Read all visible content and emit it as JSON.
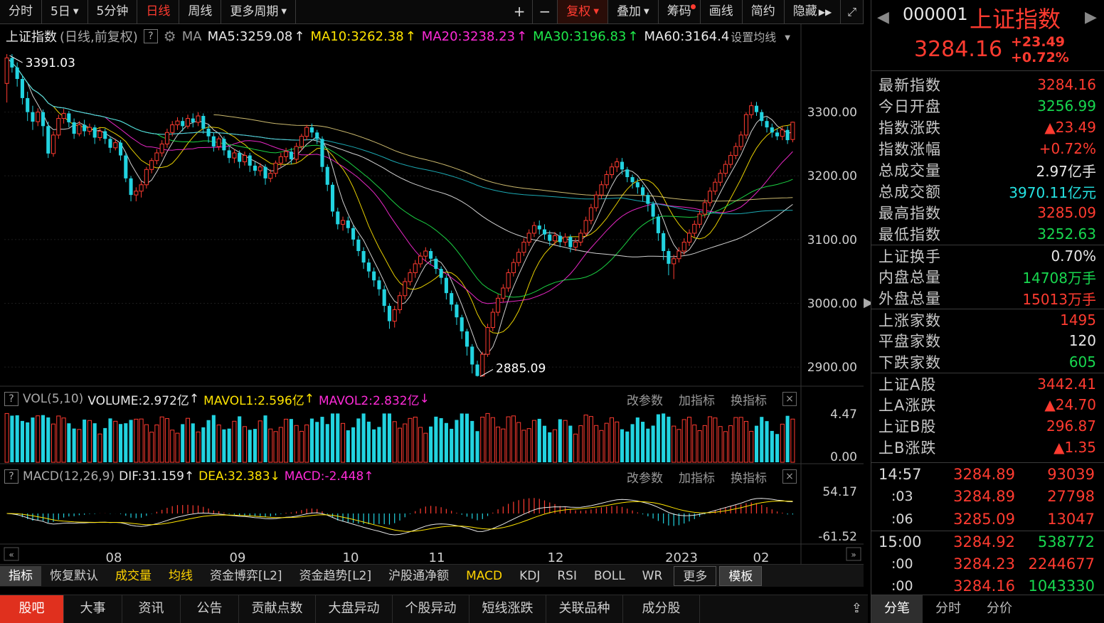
{
  "toolbar": {
    "tabs": [
      "分时",
      "5日",
      "5分钟",
      "日线",
      "周线",
      "更多周期"
    ],
    "active_tab": "日线",
    "tools": [
      "+",
      "−",
      "复权",
      "叠加",
      "筹码",
      "画线",
      "简约",
      "隐藏"
    ]
  },
  "info": {
    "name": "上证指数",
    "mode": "(日线,前复权)",
    "help": "?",
    "ma_label": "MA",
    "ma5": "MA5:3259.08",
    "ma10": "MA10:3262.38",
    "ma20": "MA20:3238.23",
    "ma30": "MA30:3196.83",
    "ma60": "MA60:3164.4",
    "set_ma": "设置均线"
  },
  "vol_head": {
    "help": "?",
    "name": "VOL(5,10)",
    "volume": "VOLUME:2.972亿",
    "mavol1": "MAVOL1:2.596亿",
    "mavol2": "MAVOL2:2.832亿",
    "actions": [
      "改参数",
      "加指标",
      "换指标"
    ],
    "close": "×"
  },
  "macd_head": {
    "help": "?",
    "name": "MACD(12,26,9)",
    "dif": "DIF:31.159",
    "dea": "DEA:32.383",
    "macd": "MACD:-2.448",
    "actions": [
      "改参数",
      "加指标",
      "换指标"
    ],
    "close": "×"
  },
  "axis": {
    "price_ticks": [
      "3300.00",
      "3200.00",
      "3100.00",
      "3000.00",
      "2900.00"
    ],
    "vol_ticks": [
      "4.47",
      "0.00"
    ],
    "macd_ticks": [
      "54.17",
      "-61.52"
    ],
    "x_labels": [
      "08",
      "09",
      "10",
      "11",
      "12",
      "2023",
      "02"
    ],
    "high_label": "3391.03",
    "low_label": "2885.09"
  },
  "colors": {
    "up": "#ff3b30",
    "down": "#22d3e0",
    "ma5": "#e8e8e8",
    "ma10": "#ffe400",
    "ma20": "#ff2bd8",
    "ma30": "#1ee84a",
    "ma60": "#e8e8e8",
    "dif": "#e8e8e8",
    "dea": "#ffe400"
  },
  "chart_data": {
    "type": "candlestick",
    "title": "上证指数",
    "x_labels": [
      "08",
      "09",
      "10",
      "11",
      "12",
      "2023",
      "02"
    ],
    "ylim": [
      2870,
      3400
    ],
    "candles": [
      [
        3345,
        3385,
        3315,
        3391
      ],
      [
        3385,
        3370,
        3362,
        3391
      ],
      [
        3370,
        3352,
        3340,
        3378
      ],
      [
        3352,
        3322,
        3312,
        3358
      ],
      [
        3322,
        3300,
        3286,
        3332
      ],
      [
        3300,
        3285,
        3272,
        3310
      ],
      [
        3285,
        3300,
        3278,
        3306
      ],
      [
        3300,
        3278,
        3262,
        3304
      ],
      [
        3278,
        3235,
        3228,
        3285
      ],
      [
        3235,
        3264,
        3230,
        3270
      ],
      [
        3264,
        3290,
        3258,
        3296
      ],
      [
        3290,
        3298,
        3282,
        3305
      ],
      [
        3298,
        3284,
        3276,
        3302
      ],
      [
        3284,
        3266,
        3258,
        3290
      ],
      [
        3266,
        3280,
        3262,
        3286
      ],
      [
        3280,
        3270,
        3262,
        3288
      ],
      [
        3270,
        3276,
        3264,
        3282
      ],
      [
        3276,
        3260,
        3250,
        3280
      ],
      [
        3260,
        3270,
        3255,
        3275
      ],
      [
        3270,
        3258,
        3250,
        3274
      ],
      [
        3258,
        3244,
        3236,
        3262
      ],
      [
        3244,
        3252,
        3240,
        3258
      ],
      [
        3252,
        3232,
        3224,
        3256
      ],
      [
        3232,
        3196,
        3190,
        3236
      ],
      [
        3196,
        3170,
        3160,
        3200
      ],
      [
        3170,
        3176,
        3160,
        3182
      ],
      [
        3176,
        3186,
        3166,
        3192
      ],
      [
        3186,
        3210,
        3180,
        3214
      ],
      [
        3210,
        3224,
        3204,
        3228
      ],
      [
        3224,
        3236,
        3218,
        3242
      ],
      [
        3236,
        3250,
        3230,
        3256
      ],
      [
        3250,
        3268,
        3244,
        3274
      ],
      [
        3268,
        3280,
        3262,
        3286
      ],
      [
        3280,
        3286,
        3272,
        3292
      ],
      [
        3286,
        3278,
        3270,
        3292
      ],
      [
        3278,
        3290,
        3274,
        3296
      ],
      [
        3290,
        3284,
        3276,
        3298
      ],
      [
        3284,
        3294,
        3278,
        3300
      ],
      [
        3294,
        3274,
        3266,
        3298
      ],
      [
        3274,
        3262,
        3252,
        3280
      ],
      [
        3262,
        3246,
        3238,
        3268
      ],
      [
        3246,
        3258,
        3240,
        3262
      ],
      [
        3258,
        3240,
        3232,
        3262
      ],
      [
        3240,
        3228,
        3220,
        3246
      ],
      [
        3228,
        3236,
        3220,
        3242
      ],
      [
        3236,
        3222,
        3212,
        3240
      ],
      [
        3222,
        3232,
        3216,
        3238
      ],
      [
        3232,
        3216,
        3206,
        3236
      ],
      [
        3216,
        3208,
        3200,
        3222
      ],
      [
        3208,
        3214,
        3200,
        3220
      ],
      [
        3214,
        3196,
        3186,
        3218
      ],
      [
        3196,
        3204,
        3190,
        3210
      ],
      [
        3204,
        3220,
        3198,
        3224
      ],
      [
        3220,
        3230,
        3214,
        3236
      ],
      [
        3230,
        3238,
        3222,
        3244
      ],
      [
        3238,
        3226,
        3218,
        3244
      ],
      [
        3226,
        3246,
        3220,
        3252
      ],
      [
        3246,
        3262,
        3240,
        3266
      ],
      [
        3262,
        3276,
        3256,
        3280
      ],
      [
        3276,
        3268,
        3260,
        3282
      ],
      [
        3268,
        3258,
        3250,
        3272
      ],
      [
        3258,
        3214,
        3206,
        3262
      ],
      [
        3214,
        3186,
        3176,
        3218
      ],
      [
        3186,
        3144,
        3136,
        3190
      ],
      [
        3144,
        3124,
        3116,
        3150
      ],
      [
        3124,
        3130,
        3114,
        3136
      ],
      [
        3130,
        3118,
        3110,
        3136
      ],
      [
        3118,
        3100,
        3090,
        3122
      ],
      [
        3100,
        3082,
        3074,
        3106
      ],
      [
        3082,
        3064,
        3054,
        3088
      ],
      [
        3064,
        3050,
        3040,
        3070
      ],
      [
        3050,
        3036,
        3026,
        3056
      ],
      [
        3036,
        3022,
        3012,
        3042
      ],
      [
        3022,
        2996,
        2986,
        3028
      ],
      [
        2996,
        2972,
        2960,
        3000
      ],
      [
        2972,
        2990,
        2962,
        2996
      ],
      [
        2990,
        3012,
        2984,
        3018
      ],
      [
        3012,
        3034,
        3006,
        3040
      ],
      [
        3034,
        3048,
        3028,
        3054
      ],
      [
        3048,
        3062,
        3040,
        3068
      ],
      [
        3062,
        3074,
        3056,
        3080
      ],
      [
        3074,
        3082,
        3066,
        3088
      ],
      [
        3082,
        3070,
        3062,
        3086
      ],
      [
        3070,
        3054,
        3046,
        3074
      ],
      [
        3054,
        3040,
        3030,
        3058
      ],
      [
        3040,
        3016,
        3006,
        3044
      ],
      [
        3016,
        2998,
        2988,
        3020
      ],
      [
        2998,
        2978,
        2966,
        3002
      ],
      [
        2978,
        2956,
        2944,
        2982
      ],
      [
        2956,
        2932,
        2918,
        2960
      ],
      [
        2932,
        2904,
        2890,
        2936
      ],
      [
        2904,
        2886,
        2885.09,
        2910
      ],
      [
        2886,
        2920,
        2885.09,
        2924
      ],
      [
        2920,
        2962,
        2916,
        2968
      ],
      [
        2962,
        2986,
        2956,
        2992
      ],
      [
        2986,
        3008,
        2980,
        3014
      ],
      [
        3008,
        3024,
        3002,
        3030
      ],
      [
        3024,
        3048,
        3018,
        3054
      ],
      [
        3048,
        3064,
        3042,
        3070
      ],
      [
        3064,
        3080,
        3058,
        3086
      ],
      [
        3080,
        3096,
        3074,
        3102
      ],
      [
        3096,
        3110,
        3090,
        3116
      ],
      [
        3110,
        3122,
        3104,
        3128
      ],
      [
        3122,
        3116,
        3108,
        3130
      ],
      [
        3116,
        3108,
        3100,
        3124
      ],
      [
        3108,
        3098,
        3090,
        3114
      ],
      [
        3098,
        3106,
        3092,
        3112
      ],
      [
        3106,
        3096,
        3088,
        3112
      ],
      [
        3096,
        3104,
        3090,
        3110
      ],
      [
        3104,
        3088,
        3080,
        3108
      ],
      [
        3088,
        3096,
        3082,
        3102
      ],
      [
        3096,
        3110,
        3090,
        3116
      ],
      [
        3110,
        3130,
        3104,
        3136
      ],
      [
        3130,
        3150,
        3124,
        3156
      ],
      [
        3150,
        3170,
        3144,
        3176
      ],
      [
        3170,
        3186,
        3164,
        3192
      ],
      [
        3186,
        3202,
        3180,
        3208
      ],
      [
        3202,
        3214,
        3196,
        3220
      ],
      [
        3214,
        3222,
        3206,
        3228
      ],
      [
        3222,
        3210,
        3202,
        3228
      ],
      [
        3210,
        3198,
        3190,
        3214
      ],
      [
        3198,
        3190,
        3180,
        3202
      ],
      [
        3190,
        3182,
        3172,
        3196
      ],
      [
        3182,
        3170,
        3160,
        3186
      ],
      [
        3170,
        3156,
        3144,
        3174
      ],
      [
        3156,
        3136,
        3124,
        3160
      ],
      [
        3136,
        3110,
        3098,
        3140
      ],
      [
        3110,
        3082,
        3068,
        3114
      ],
      [
        3082,
        3062,
        3044,
        3086
      ],
      [
        3062,
        3070,
        3038,
        3076
      ],
      [
        3070,
        3082,
        3064,
        3088
      ],
      [
        3082,
        3096,
        3076,
        3102
      ],
      [
        3096,
        3110,
        3090,
        3116
      ],
      [
        3110,
        3124,
        3104,
        3130
      ],
      [
        3124,
        3140,
        3118,
        3146
      ],
      [
        3140,
        3158,
        3134,
        3164
      ],
      [
        3158,
        3176,
        3152,
        3182
      ],
      [
        3176,
        3190,
        3170,
        3196
      ],
      [
        3190,
        3204,
        3184,
        3210
      ],
      [
        3204,
        3218,
        3198,
        3224
      ],
      [
        3218,
        3232,
        3212,
        3238
      ],
      [
        3232,
        3246,
        3226,
        3252
      ],
      [
        3246,
        3264,
        3240,
        3270
      ],
      [
        3264,
        3296,
        3258,
        3300
      ],
      [
        3296,
        3310,
        3290,
        3316
      ],
      [
        3310,
        3300,
        3294,
        3316
      ],
      [
        3300,
        3286,
        3278,
        3304
      ],
      [
        3286,
        3276,
        3268,
        3292
      ],
      [
        3276,
        3268,
        3260,
        3282
      ],
      [
        3268,
        3262,
        3256,
        3274
      ],
      [
        3262,
        3272,
        3256,
        3278
      ],
      [
        3272,
        3256,
        3250,
        3278
      ],
      [
        3256.99,
        3284.16,
        3252.63,
        3285.09
      ]
    ]
  },
  "right": {
    "code": "000001",
    "name": "上证指数",
    "price": "3284.16",
    "change": "+23.49",
    "change_pct": "+0.72%",
    "rows1": [
      {
        "label": "最新指数",
        "value": "3284.16",
        "cls": "red"
      },
      {
        "label": "今日开盘",
        "value": "3256.99",
        "cls": "grn"
      },
      {
        "label": "指数涨跌",
        "value": "▲23.49",
        "cls": "red"
      },
      {
        "label": "指数涨幅",
        "value": "+0.72%",
        "cls": "red"
      },
      {
        "label": "总成交量",
        "value": "2.97亿手",
        "cls": "wht"
      },
      {
        "label": "总成交额",
        "value": "3970.11亿元",
        "cls": "cyn"
      },
      {
        "label": "最高指数",
        "value": "3285.09",
        "cls": "red"
      },
      {
        "label": "最低指数",
        "value": "3252.63",
        "cls": "grn"
      }
    ],
    "rows2": [
      {
        "label": "上证换手",
        "value": "0.70%",
        "cls": "wht"
      },
      {
        "label": "内盘总量",
        "value": "14708万手",
        "cls": "grn"
      },
      {
        "label": "外盘总量",
        "value": "15013万手",
        "cls": "red"
      }
    ],
    "rows3": [
      {
        "label": "上涨家数",
        "value": "1495",
        "cls": "red"
      },
      {
        "label": "平盘家数",
        "value": "120",
        "cls": "wht"
      },
      {
        "label": "下跌家数",
        "value": "605",
        "cls": "grn"
      }
    ],
    "rows4": [
      {
        "label": "上证A股",
        "value": "3442.41",
        "cls": "red"
      },
      {
        "label": "上A涨跌",
        "value": "▲24.70",
        "cls": "red"
      },
      {
        "label": "上证B股",
        "value": "296.87",
        "cls": "red"
      },
      {
        "label": "上B涨跌",
        "value": "▲1.35",
        "cls": "red"
      }
    ],
    "ticks": [
      {
        "time": "14:57",
        "price": "3284.89",
        "vol": "93039",
        "sub": false
      },
      {
        "time": ":03",
        "price": "3284.89",
        "vol": "27798",
        "sub": true
      },
      {
        "time": ":06",
        "price": "3285.09",
        "vol": "13047",
        "sub": true
      },
      {
        "time": "15:00",
        "price": "3284.92",
        "vol": "538772",
        "sub": false
      },
      {
        "time": ":00",
        "price": "3284.23",
        "vol": "2244677",
        "sub": true
      },
      {
        "time": ":00",
        "price": "3284.16",
        "vol": "1043330",
        "sub": true
      }
    ],
    "tabs": [
      "分笔",
      "分时",
      "分价"
    ]
  },
  "indicator_tabs": [
    "指标",
    "恢复默认",
    "成交量",
    "均线",
    "资金博弈[L2]",
    "资金趋势[L2]",
    "沪股通净额",
    "MACD",
    "KDJ",
    "RSI",
    "BOLL",
    "WR",
    "更多",
    "模板"
  ],
  "bottom_tabs": [
    "股吧",
    "大事",
    "资讯",
    "公告",
    "贡献点数",
    "大盘异动",
    "个股异动",
    "短线涨跌",
    "关联品种",
    "成分股"
  ]
}
